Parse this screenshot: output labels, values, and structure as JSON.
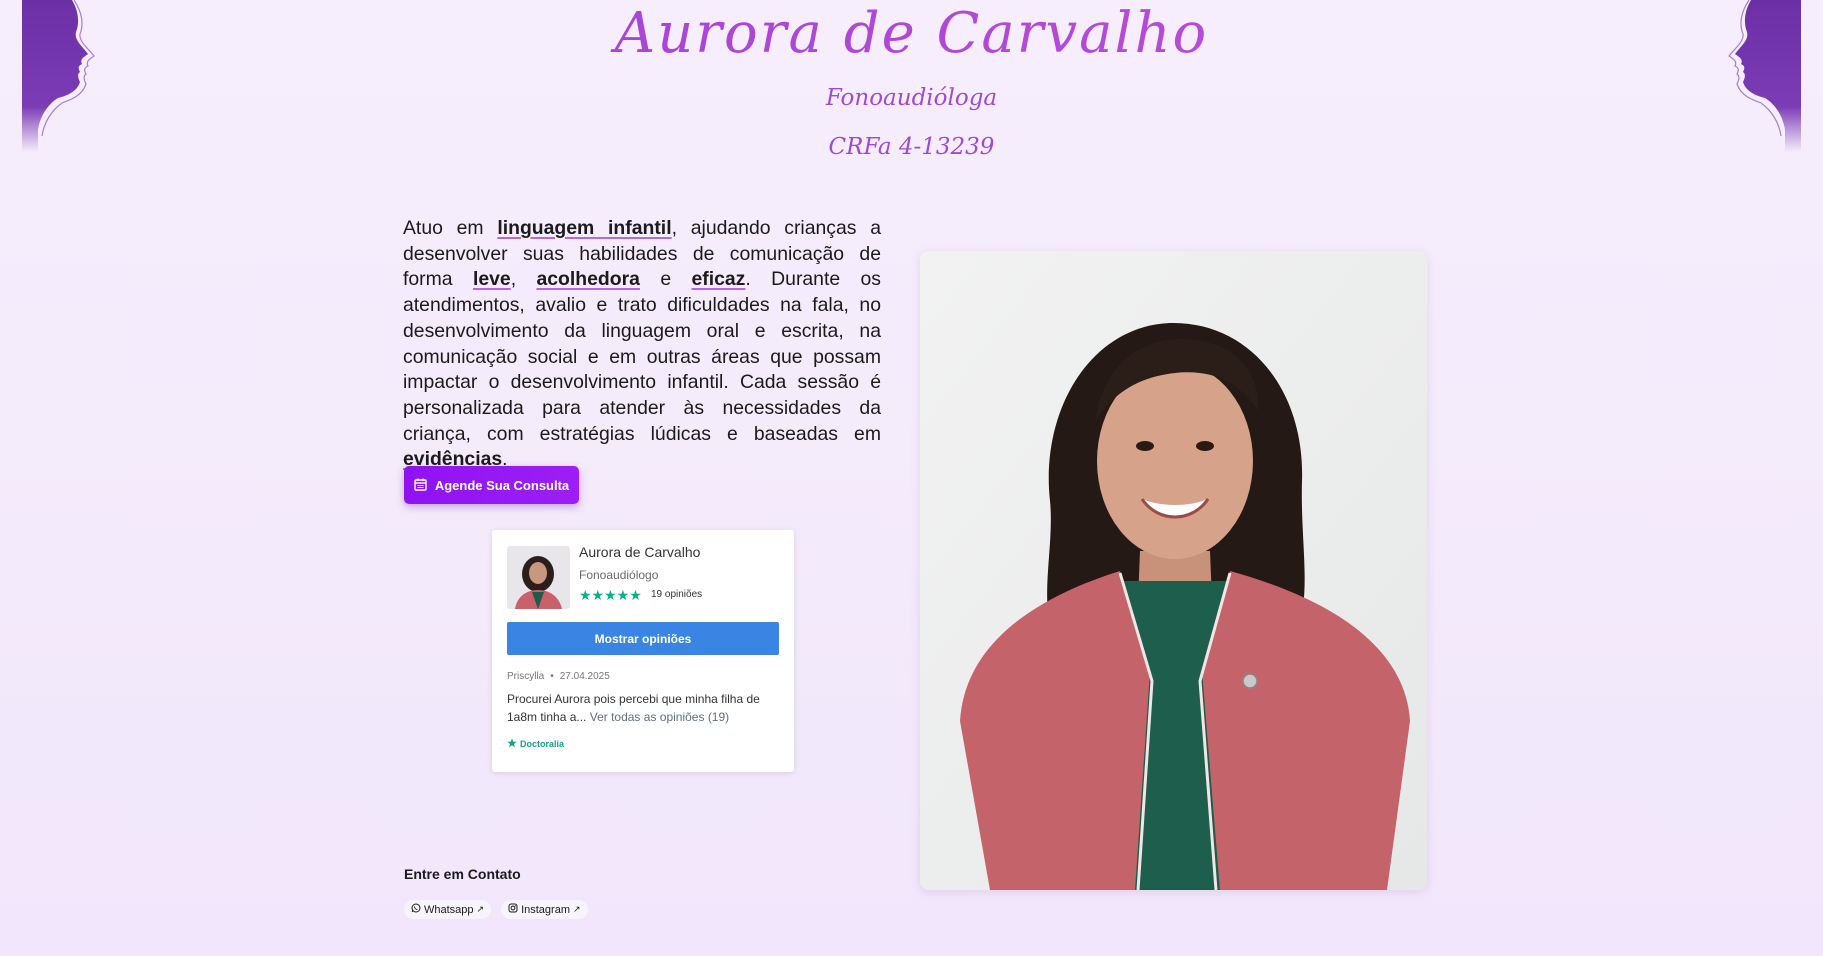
{
  "header": {
    "name": "Aurora de Carvalho",
    "subtitle": "Fonoaudióloga",
    "registration": "CRFa 4-13239"
  },
  "bio": {
    "p1": "Atuo em ",
    "k1": "linguagem infantil",
    "p2": ", ajudando crianças a desenvolver suas habilidades de comunicação de forma ",
    "k2": "leve",
    "p3": ", ",
    "k3": "acolhedora",
    "p4": " e ",
    "k4": "eficaz",
    "p5": ". Durante os atendimentos, avalio e trato dificuldades na fala, no desenvolvimento da linguagem oral e escrita, na comunicação social e em outras áreas que possam impactar o desenvolvimento infantil. Cada sessão é personalizada para atender às necessidades da criança, com estratégias lúdicas e baseadas em ",
    "k5": "evidências",
    "p6": "."
  },
  "cta": {
    "label": "Agende Sua Consulta",
    "icon": "calendar-icon"
  },
  "review_widget": {
    "name": "Aurora de Carvalho",
    "role": "Fonoaudiólogo",
    "stars": "★★★★★",
    "rating": 5,
    "reviews_count": "19 opiniões",
    "button": "Mostrar opiniões",
    "review": {
      "author": "Priscylla",
      "separator": "•",
      "date": "27.04.2025",
      "text": "Procurei Aurora pois percebi que minha filha de 1a8m tinha a...",
      "link": "Ver todas as opiniões (19)"
    },
    "brand": "Doctoralia"
  },
  "contact": {
    "title": "Entre em Contato",
    "links": [
      {
        "label": "Whatsapp",
        "icon": "whatsapp-icon",
        "external": "↗"
      },
      {
        "label": "Instagram",
        "icon": "instagram-icon",
        "external": "↗"
      }
    ]
  },
  "colors": {
    "accent": "#9d4bd2",
    "cta": "#8f12f2",
    "review_button": "#3a85e3",
    "star": "#00b38a",
    "background": "#f6eefc"
  }
}
